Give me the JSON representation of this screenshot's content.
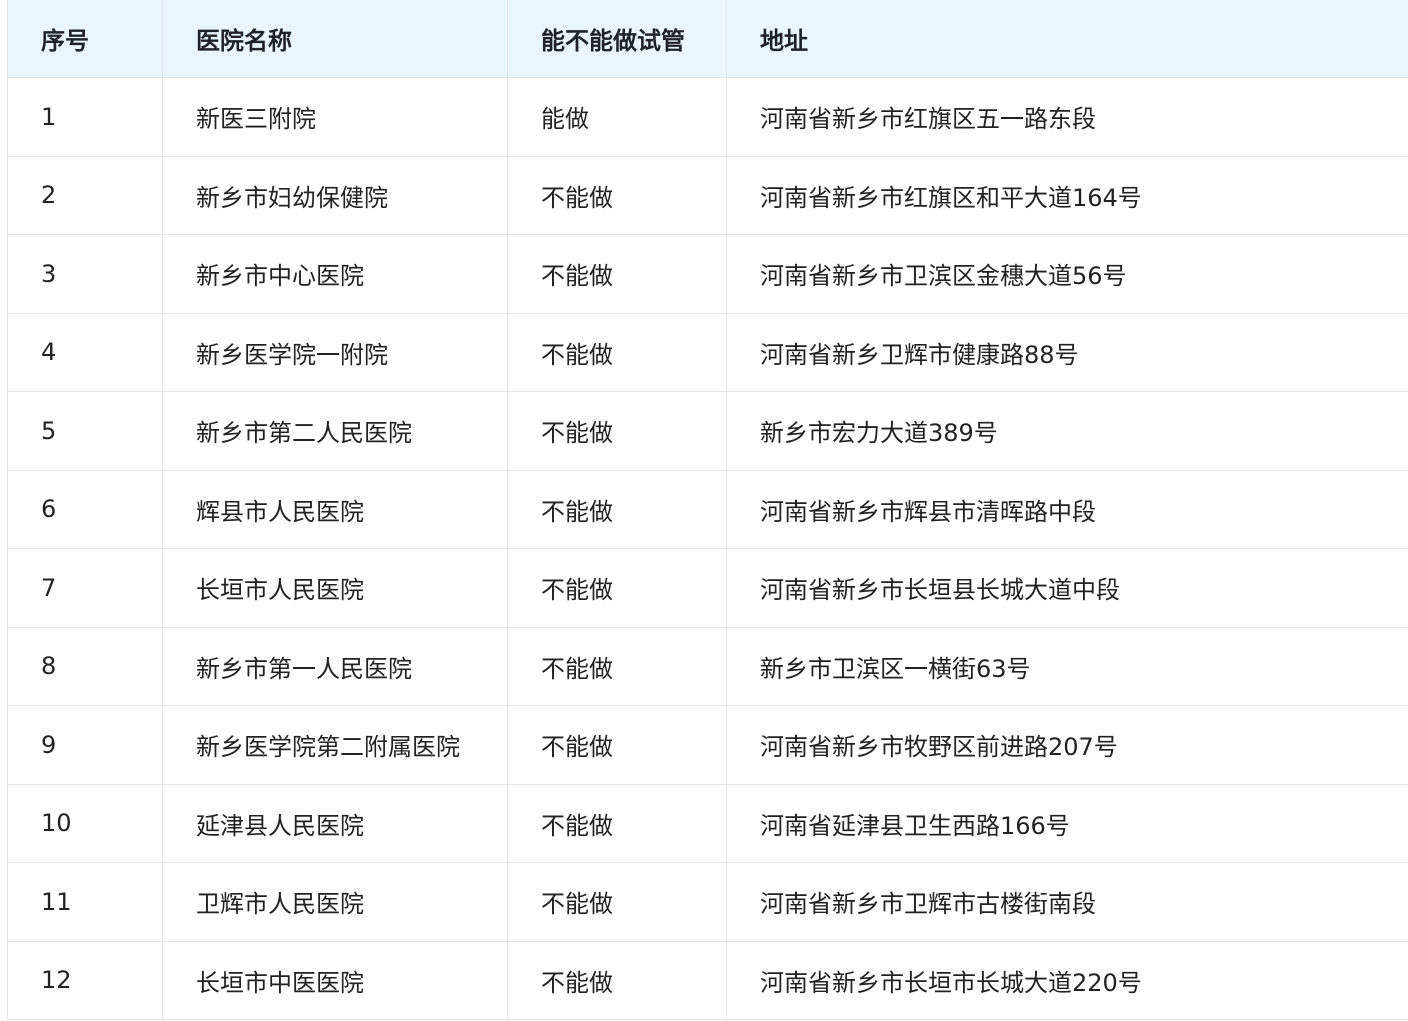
{
  "table": {
    "headers": [
      "序号",
      "医院名称",
      "能不能做试管",
      "地址"
    ],
    "rows": [
      [
        "1",
        "新医三附院",
        "能做",
        "河南省新乡市红旗区五一路东段"
      ],
      [
        "2",
        "新乡市妇幼保健院",
        "不能做",
        "河南省新乡市红旗区和平大道164号"
      ],
      [
        "3",
        "新乡市中心医院",
        "不能做",
        "河南省新乡市卫滨区金穗大道56号"
      ],
      [
        "4",
        "新乡医学院一附院",
        "不能做",
        "河南省新乡卫辉市健康路88号"
      ],
      [
        "5",
        "新乡市第二人民医院",
        "不能做",
        "新乡市宏力大道389号"
      ],
      [
        "6",
        "辉县市人民医院",
        "不能做",
        "河南省新乡市辉县市清晖路中段"
      ],
      [
        "7",
        "长垣市人民医院",
        "不能做",
        "河南省新乡市长垣县长城大道中段"
      ],
      [
        "8",
        "新乡市第一人民医院",
        "不能做",
        "新乡市卫滨区一横街63号"
      ],
      [
        "9",
        "新乡医学院第二附属医院",
        "不能做",
        "河南省新乡市牧野区前进路207号"
      ],
      [
        "10",
        "延津县人民医院",
        "不能做",
        "河南省延津县卫生西路166号"
      ],
      [
        "11",
        "卫辉市人民医院",
        "不能做",
        "河南省新乡市卫辉市古楼街南段"
      ],
      [
        "12",
        "长垣市中医医院",
        "不能做",
        "河南省新乡市长垣市长城大道220号"
      ]
    ]
  },
  "colors": {
    "header_bg": "#eaf5ff",
    "border": "#e3e6ea",
    "text": "#222222"
  }
}
